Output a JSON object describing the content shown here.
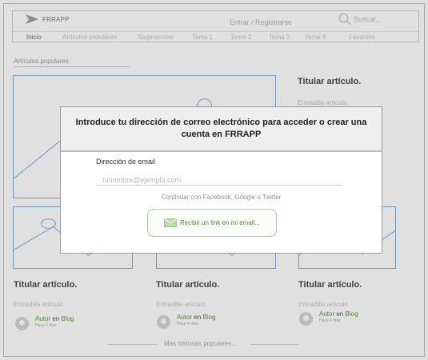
{
  "app": {
    "name": "FRRAPP"
  },
  "header": {
    "login_label": "Entrar / Registrarse",
    "search_placeholder": "Buscar..."
  },
  "nav": {
    "items": [
      {
        "label": "Inicio",
        "active": true
      },
      {
        "label": "Artículos populares",
        "active": false
      },
      {
        "label": "Sugerencias",
        "active": false
      },
      {
        "label": "Tema 1",
        "active": false
      },
      {
        "label": "Tema 2",
        "active": false
      },
      {
        "label": "Tema 3",
        "active": false
      },
      {
        "label": "Tema  4",
        "active": false
      },
      {
        "label": "Favoritos",
        "active": false
      }
    ]
  },
  "section": {
    "title": "Artículos populares."
  },
  "featured": {
    "title": "Titular artículo.",
    "subtitle": "Entradilla artículo."
  },
  "articles": [
    {
      "title": "Titular artículo.",
      "subtitle": "Entradilla artículo.",
      "author": "Autor",
      "in": "en",
      "blog": "Blog",
      "time": "Hace 4 días"
    },
    {
      "title": "Titular artículo.",
      "subtitle": "Entradilla artículo.",
      "author": "Autor",
      "in": "en",
      "blog": "Blog",
      "time": "Hace 4 días"
    },
    {
      "title": "Titular artículo.",
      "subtitle": "Entradilla artículo.",
      "author": "Autor",
      "in": "en",
      "blog": "Blog",
      "time": "Hace 4 días"
    }
  ],
  "more_link": "Mas historias populares...",
  "modal": {
    "title": "Introduce tu dirección de correo electrónico para acceder o crear una cuenta en FRRAPP",
    "email_label": "Dirección de email",
    "email_placeholder": "tunombre@ejemplo.com",
    "email_value": "",
    "social_text": "Continuar con Facebook, Google o Twitter",
    "button_label": "Recibir un link en mi email...",
    "button_icon": "envelope-icon"
  },
  "colors": {
    "accent_green": "#5c9a3a",
    "placeholder_blue": "#7fb0d8",
    "logo_gray": "#9e9e9e"
  },
  "icons": {
    "logo": "arrow-logo-icon",
    "search": "search-icon",
    "avatar": "user-avatar-icon"
  }
}
